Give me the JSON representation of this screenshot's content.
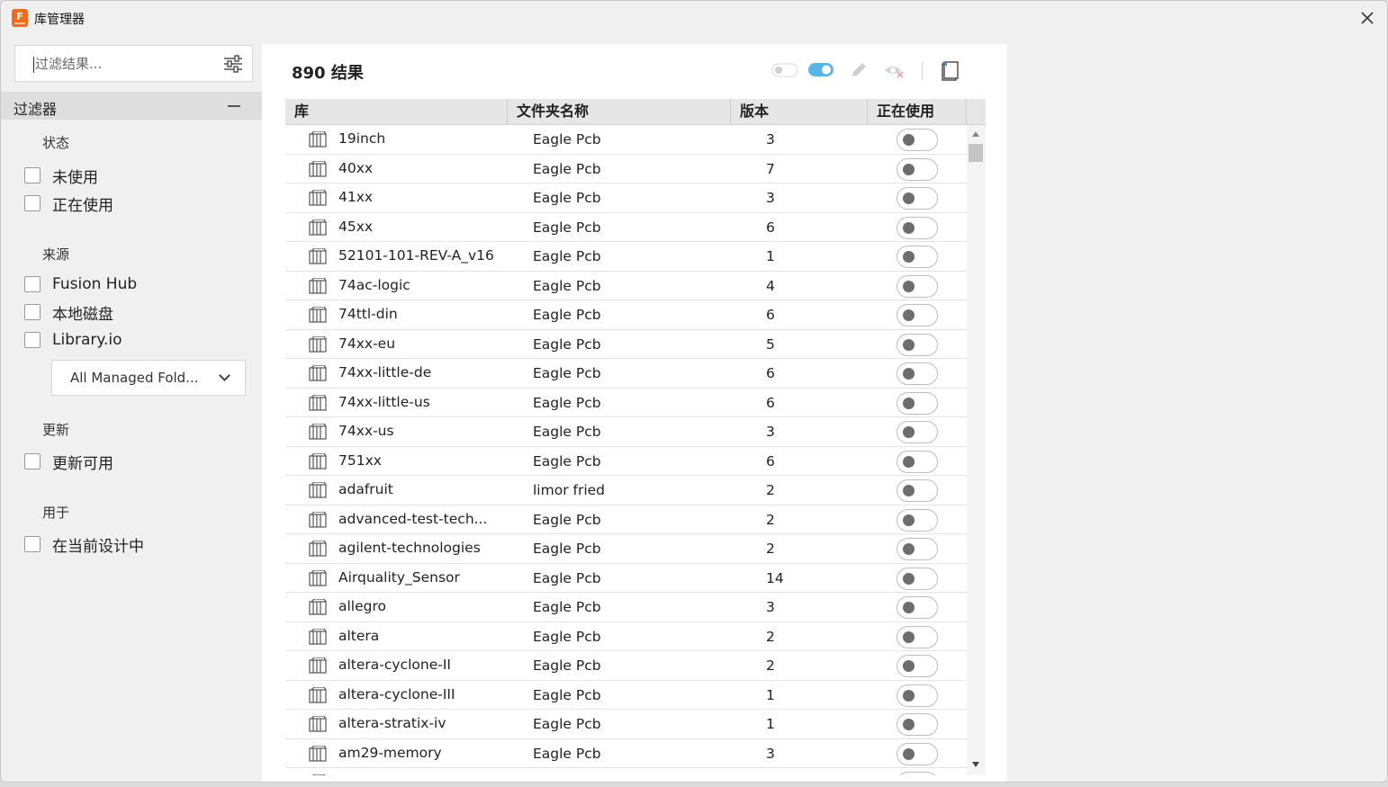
{
  "window": {
    "title": "库管理器",
    "app_icon_letter": "F"
  },
  "sidebar": {
    "search_placeholder": "过滤结果...",
    "filters_header": "过滤器",
    "sections": {
      "status": {
        "label": "状态",
        "options": [
          "未使用",
          "正在使用"
        ]
      },
      "source": {
        "label": "来源",
        "options": [
          "Fusion Hub",
          "本地磁盘",
          "Library.io"
        ],
        "dropdown_value": "All Managed Fold..."
      },
      "updates": {
        "label": "更新",
        "options": [
          "更新可用"
        ]
      },
      "used_in": {
        "label": "用于",
        "options": [
          "在当前设计中"
        ]
      }
    }
  },
  "main": {
    "result_count": "890 结果",
    "columns": [
      "库",
      "文件夹名称",
      "版本",
      "正在使用"
    ],
    "rows": [
      {
        "name": "19inch",
        "folder": "Eagle Pcb",
        "version": "3"
      },
      {
        "name": "40xx",
        "folder": "Eagle Pcb",
        "version": "7"
      },
      {
        "name": "41xx",
        "folder": "Eagle Pcb",
        "version": "3"
      },
      {
        "name": "45xx",
        "folder": "Eagle Pcb",
        "version": "6"
      },
      {
        "name": "52101-101-REV-A_v16",
        "folder": "Eagle Pcb",
        "version": "1"
      },
      {
        "name": "74ac-logic",
        "folder": "Eagle Pcb",
        "version": "4"
      },
      {
        "name": "74ttl-din",
        "folder": "Eagle Pcb",
        "version": "6"
      },
      {
        "name": "74xx-eu",
        "folder": "Eagle Pcb",
        "version": "5"
      },
      {
        "name": "74xx-little-de",
        "folder": "Eagle Pcb",
        "version": "6"
      },
      {
        "name": "74xx-little-us",
        "folder": "Eagle Pcb",
        "version": "6"
      },
      {
        "name": "74xx-us",
        "folder": "Eagle Pcb",
        "version": "3"
      },
      {
        "name": "751xx",
        "folder": "Eagle Pcb",
        "version": "6"
      },
      {
        "name": "adafruit",
        "folder": "limor fried",
        "version": "2"
      },
      {
        "name": "advanced-test-tech...",
        "folder": "Eagle Pcb",
        "version": "2"
      },
      {
        "name": "agilent-technologies",
        "folder": "Eagle Pcb",
        "version": "2"
      },
      {
        "name": "Airquality_Sensor",
        "folder": "Eagle Pcb",
        "version": "14"
      },
      {
        "name": "allegro",
        "folder": "Eagle Pcb",
        "version": "3"
      },
      {
        "name": "altera",
        "folder": "Eagle Pcb",
        "version": "2"
      },
      {
        "name": "altera-cyclone-II",
        "folder": "Eagle Pcb",
        "version": "2"
      },
      {
        "name": "altera-cyclone-III",
        "folder": "Eagle Pcb",
        "version": "1"
      },
      {
        "name": "altera-stratix-iv",
        "folder": "Eagle Pcb",
        "version": "1"
      },
      {
        "name": "am29-memory",
        "folder": "Eagle Pcb",
        "version": "3"
      },
      {
        "name": "",
        "folder": "",
        "version": ""
      }
    ],
    "colors": {
      "accent": "#5ab4e8",
      "toggle_knob": "#6d6d6d"
    }
  }
}
